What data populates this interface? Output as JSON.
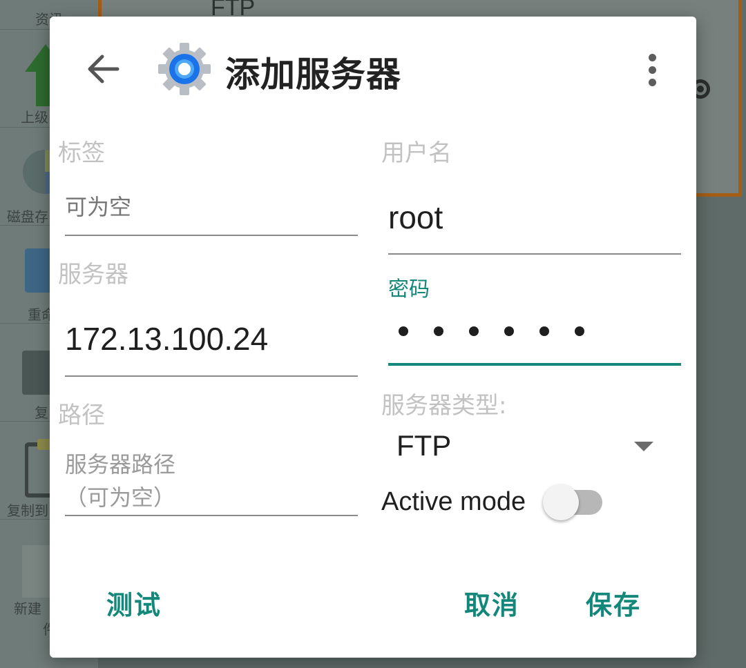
{
  "background": {
    "sidebar_items": [
      "资讯",
      "上级",
      "磁盘存",
      "重命",
      "复",
      "复制到",
      "新建",
      "件"
    ],
    "card_title": "FTP"
  },
  "dialog": {
    "title": "添加服务器",
    "icons": {
      "back": "arrow-left-icon",
      "app": "gear-icon",
      "menu": "more-vertical-icon"
    },
    "fields": {
      "label": {
        "label": "标签",
        "placeholder": "可为空",
        "value": ""
      },
      "server": {
        "label": "服务器",
        "value": "172.13.100.24"
      },
      "path": {
        "label": "路径",
        "placeholder_line1": "服务器路径",
        "placeholder_line2": "（可为空）",
        "value": ""
      },
      "username": {
        "label": "用户名",
        "value": "root"
      },
      "password": {
        "label": "密码",
        "masked_length": 6
      },
      "server_type": {
        "label": "服务器类型:",
        "selected": "FTP"
      }
    },
    "active_mode": {
      "label": "Active mode",
      "enabled": false
    },
    "buttons": {
      "test": "测试",
      "cancel": "取消",
      "save": "保存"
    },
    "colors": {
      "accent": "#13877a",
      "hint": "#c2c2c2",
      "scrim": "#53605d"
    }
  }
}
